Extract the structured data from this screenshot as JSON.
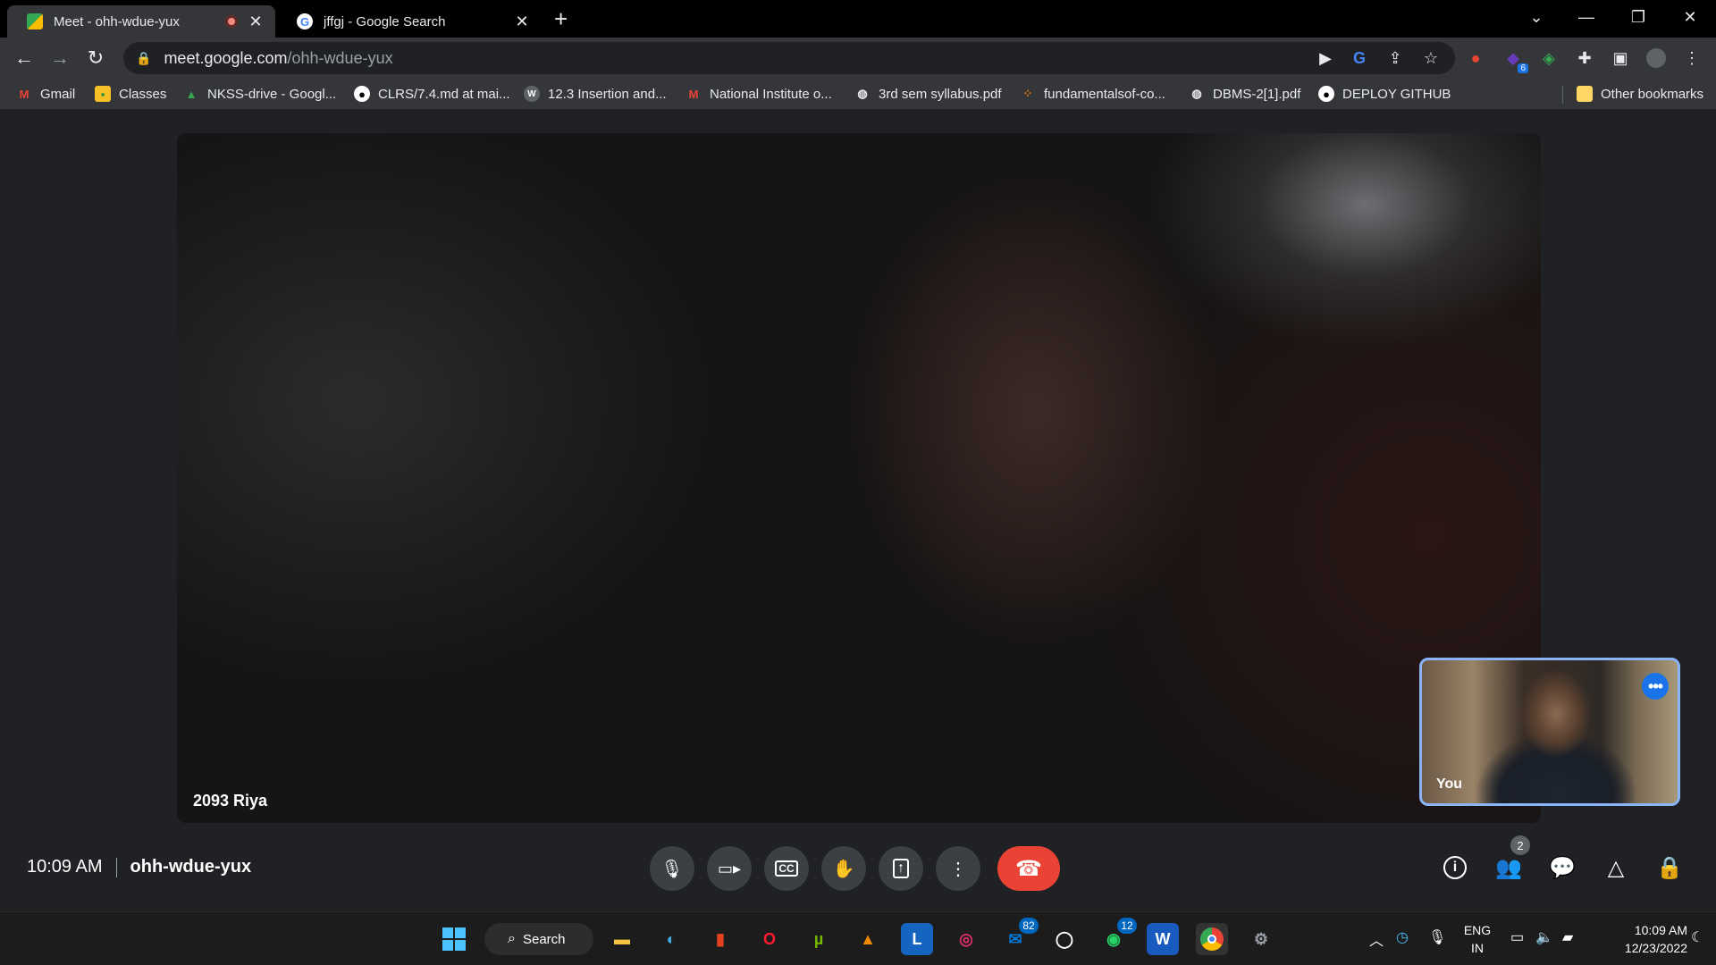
{
  "browser": {
    "tabs": [
      {
        "title": "Meet - ohh-wdue-yux",
        "recording": true,
        "active": true
      },
      {
        "title": "jffgj - Google Search",
        "active": false
      }
    ],
    "url_host": "meet.google.com",
    "url_path": "/ohh-wdue-yux",
    "extension_badge": "6"
  },
  "bookmarks": [
    {
      "label": "Gmail",
      "icon": "gmail-icon",
      "color": "#ea4335"
    },
    {
      "label": "Classes",
      "icon": "classroom-icon",
      "color": "#f6c026"
    },
    {
      "label": "NKSS-drive - Googl...",
      "icon": "drive-icon",
      "color": "#34a853"
    },
    {
      "label": "CLRS/7.4.md at mai...",
      "icon": "github-icon",
      "color": "#ffffff"
    },
    {
      "label": "12.3 Insertion and...",
      "icon": "w-icon",
      "color": "#9aa0a6"
    },
    {
      "label": "National Institute o...",
      "icon": "gmail-icon",
      "color": "#ea4335"
    },
    {
      "label": "3rd sem syllabus.pdf",
      "icon": "globe-icon",
      "color": "#9aa0a6"
    },
    {
      "label": "fundamentalsof-co...",
      "icon": "dots-icon",
      "color": "#e8710a"
    },
    {
      "label": "DBMS-2[1].pdf",
      "icon": "globe-icon",
      "color": "#9aa0a6"
    },
    {
      "label": "DEPLOY GITHUB",
      "icon": "github-icon",
      "color": "#ffffff"
    }
  ],
  "other_bookmarks": "Other bookmarks",
  "meet": {
    "main_participant": "2093 Riya",
    "self_label": "You",
    "time": "10:09 AM",
    "meeting_code": "ohh-wdue-yux",
    "people_count": "2"
  },
  "taskbar": {
    "search_label": "Search",
    "outlook_badge": "82",
    "whatsapp_badge": "12",
    "lang_line1": "ENG",
    "lang_line2": "IN",
    "time": "10:09 AM",
    "date": "12/23/2022"
  }
}
